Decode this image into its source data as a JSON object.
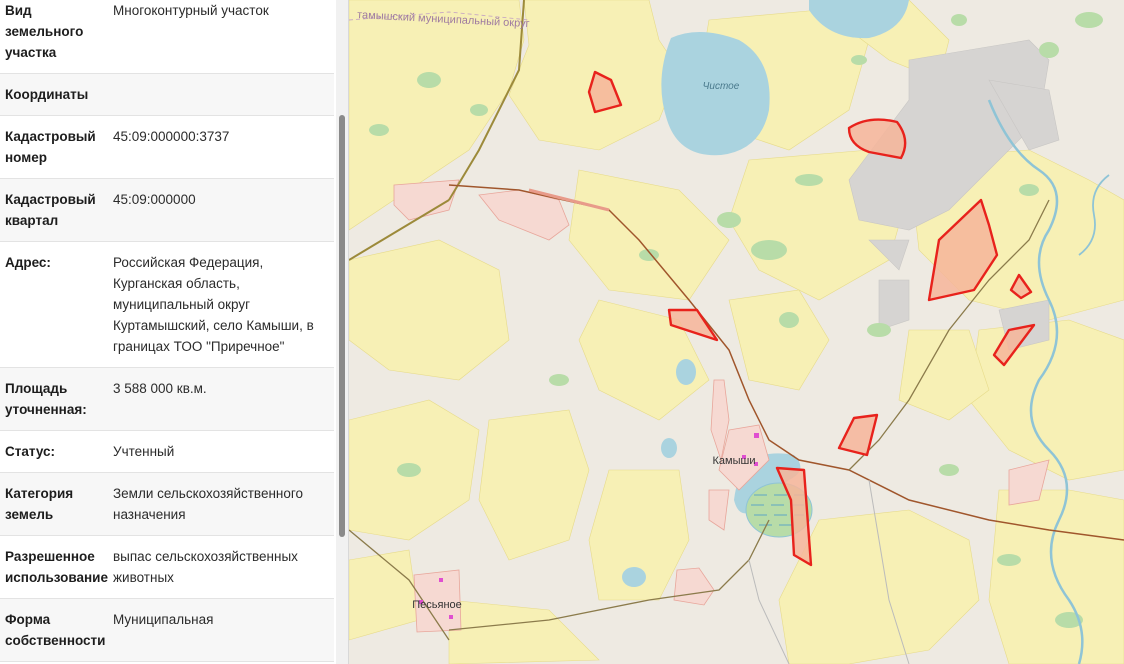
{
  "properties": [
    {
      "key": "Вид земельного участка",
      "value": "Многоконтурный участок"
    },
    {
      "key": "Координаты",
      "value": ""
    },
    {
      "key": "Кадастровый номер",
      "value": "45:09:000000:3737"
    },
    {
      "key": "Кадастровый квартал",
      "value": "45:09:000000"
    },
    {
      "key": "Адрес:",
      "value": "Российская Федерация, Курганская область, муниципальный округ Куртамышский, село Камыши, в границах ТОО \"Приречное\""
    },
    {
      "key": "Площадь уточненная:",
      "value": "3 588 000 кв.м."
    },
    {
      "key": "Статус:",
      "value": "Учтенный"
    },
    {
      "key": "Категория земель",
      "value": "Земли сельскохозяйственного назначения"
    },
    {
      "key": "Разрешенное использование",
      "value": "выпас сельскохозяйственных животных"
    },
    {
      "key": "Форма собственности",
      "value": "Муниципальная"
    }
  ],
  "map": {
    "labels": {
      "district": "тамышский муниципальный округ",
      "lake": "Чистое",
      "village1": "Камыши",
      "village2": "Песьяное"
    },
    "colors": {
      "field": "#f7f0b5",
      "forest": "#b8dca8",
      "water": "#aad3df",
      "parcel_fill": "#f6b59a",
      "parcel_stroke": "#e8221c",
      "industrial": "#dcdcdc",
      "residential": "#f6d9d2"
    }
  }
}
